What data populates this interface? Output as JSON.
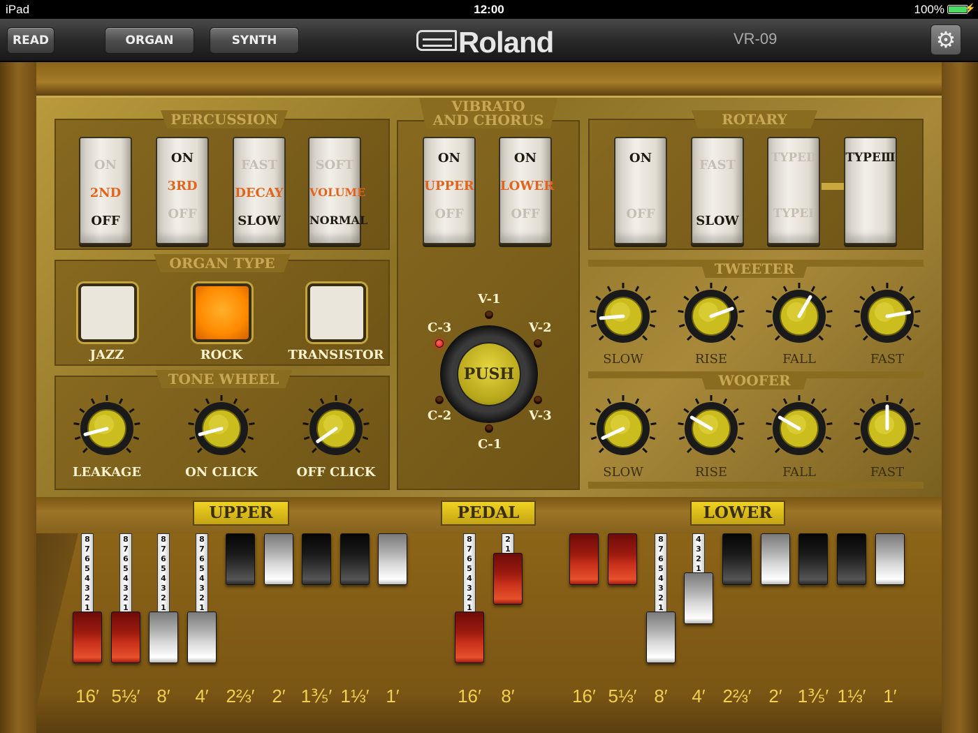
{
  "status": {
    "device": "iPad",
    "time": "12:00",
    "battery": "100%"
  },
  "toolbar": {
    "read": "READ",
    "organ": "ORGAN",
    "synth": "SYNTH",
    "brand": "Roland",
    "model": "VR-09",
    "settings_icon": "gear-icon"
  },
  "percussion": {
    "title": "PERCUSSION",
    "switches": [
      {
        "top": "ON",
        "mid": "2ND",
        "bot": "OFF"
      },
      {
        "top": "ON",
        "mid": "3RD",
        "bot": "OFF"
      },
      {
        "top": "FAST",
        "mid": "DECAY",
        "bot": "SLOW"
      },
      {
        "top": "SOFT",
        "mid": "VOLUME",
        "bot": "NORMAL"
      }
    ]
  },
  "vibrato": {
    "title1": "VIBRATO",
    "title2": "AND CHORUS",
    "switches": [
      {
        "top": "ON",
        "mid": "UPPER",
        "bot": "OFF"
      },
      {
        "top": "ON",
        "mid": "LOWER",
        "bot": "OFF"
      }
    ],
    "selector": {
      "push": "PUSH",
      "labels": [
        "V-1",
        "V-2",
        "V-3",
        "C-1",
        "C-2",
        "C-3"
      ],
      "selected": "C-3"
    }
  },
  "rotary": {
    "title": "ROTARY",
    "switches": [
      {
        "top": "ON",
        "bot": "OFF"
      },
      {
        "top": "FAST",
        "bot": "SLOW"
      },
      {
        "top": "TYPEⅡ",
        "bot": "TYPEⅠ"
      },
      {
        "top": "TYPEⅢ",
        "bot": ""
      }
    ]
  },
  "organ_type": {
    "title": "ORGAN TYPE",
    "options": [
      "JAZZ",
      "ROCK",
      "TRANSISTOR"
    ],
    "selected": "ROCK"
  },
  "tone_wheel": {
    "title": "TONE WHEEL",
    "knobs": [
      {
        "label": "LEAKAGE",
        "angle": -105
      },
      {
        "label": "ON CLICK",
        "angle": -105
      },
      {
        "label": "OFF CLICK",
        "angle": -125
      }
    ]
  },
  "tweeter": {
    "title": "TWEETER",
    "knobs": [
      {
        "label": "SLOW",
        "angle": -95
      },
      {
        "label": "RISE",
        "angle": 70
      },
      {
        "label": "FALL",
        "angle": 30
      },
      {
        "label": "FAST",
        "angle": 80
      }
    ]
  },
  "woofer": {
    "title": "WOOFER",
    "knobs": [
      {
        "label": "SLOW",
        "angle": -115
      },
      {
        "label": "RISE",
        "angle": -60
      },
      {
        "label": "FALL",
        "angle": -60
      },
      {
        "label": "FAST",
        "angle": 0
      }
    ]
  },
  "drawbar_sections": {
    "upper": "UPPER",
    "pedal": "PEDAL",
    "lower": "LOWER"
  },
  "drawbar_scale": [
    "8",
    "7",
    "6",
    "5",
    "4",
    "3",
    "2",
    "1"
  ],
  "upper_footages": [
    "16′",
    "5⅓′",
    "8′",
    "4′",
    "2⅔′",
    "2′",
    "1⅗′",
    "1⅓′",
    "1′"
  ],
  "pedal_footages": [
    "16′",
    "8′"
  ],
  "lower_footages": [
    "16′",
    "5⅓′",
    "8′",
    "4′",
    "2⅔′",
    "2′",
    "1⅗′",
    "1⅓′",
    "1′"
  ],
  "upper_drawbars": [
    {
      "color": "red",
      "level": 8
    },
    {
      "color": "red",
      "level": 8
    },
    {
      "color": "white",
      "level": 8
    },
    {
      "color": "white",
      "level": 8
    },
    {
      "color": "black",
      "level": 0
    },
    {
      "color": "white",
      "level": 0
    },
    {
      "color": "black",
      "level": 0
    },
    {
      "color": "black",
      "level": 0
    },
    {
      "color": "white",
      "level": 0
    }
  ],
  "pedal_drawbars": [
    {
      "color": "red",
      "level": 8
    },
    {
      "color": "red",
      "level": 2
    }
  ],
  "lower_drawbars": [
    {
      "color": "red",
      "level": 0
    },
    {
      "color": "red",
      "level": 0
    },
    {
      "color": "white",
      "level": 8
    },
    {
      "color": "white",
      "level": 4
    },
    {
      "color": "black",
      "level": 0
    },
    {
      "color": "white",
      "level": 0
    },
    {
      "color": "black",
      "level": 0
    },
    {
      "color": "black",
      "level": 0
    },
    {
      "color": "white",
      "level": 0
    }
  ]
}
